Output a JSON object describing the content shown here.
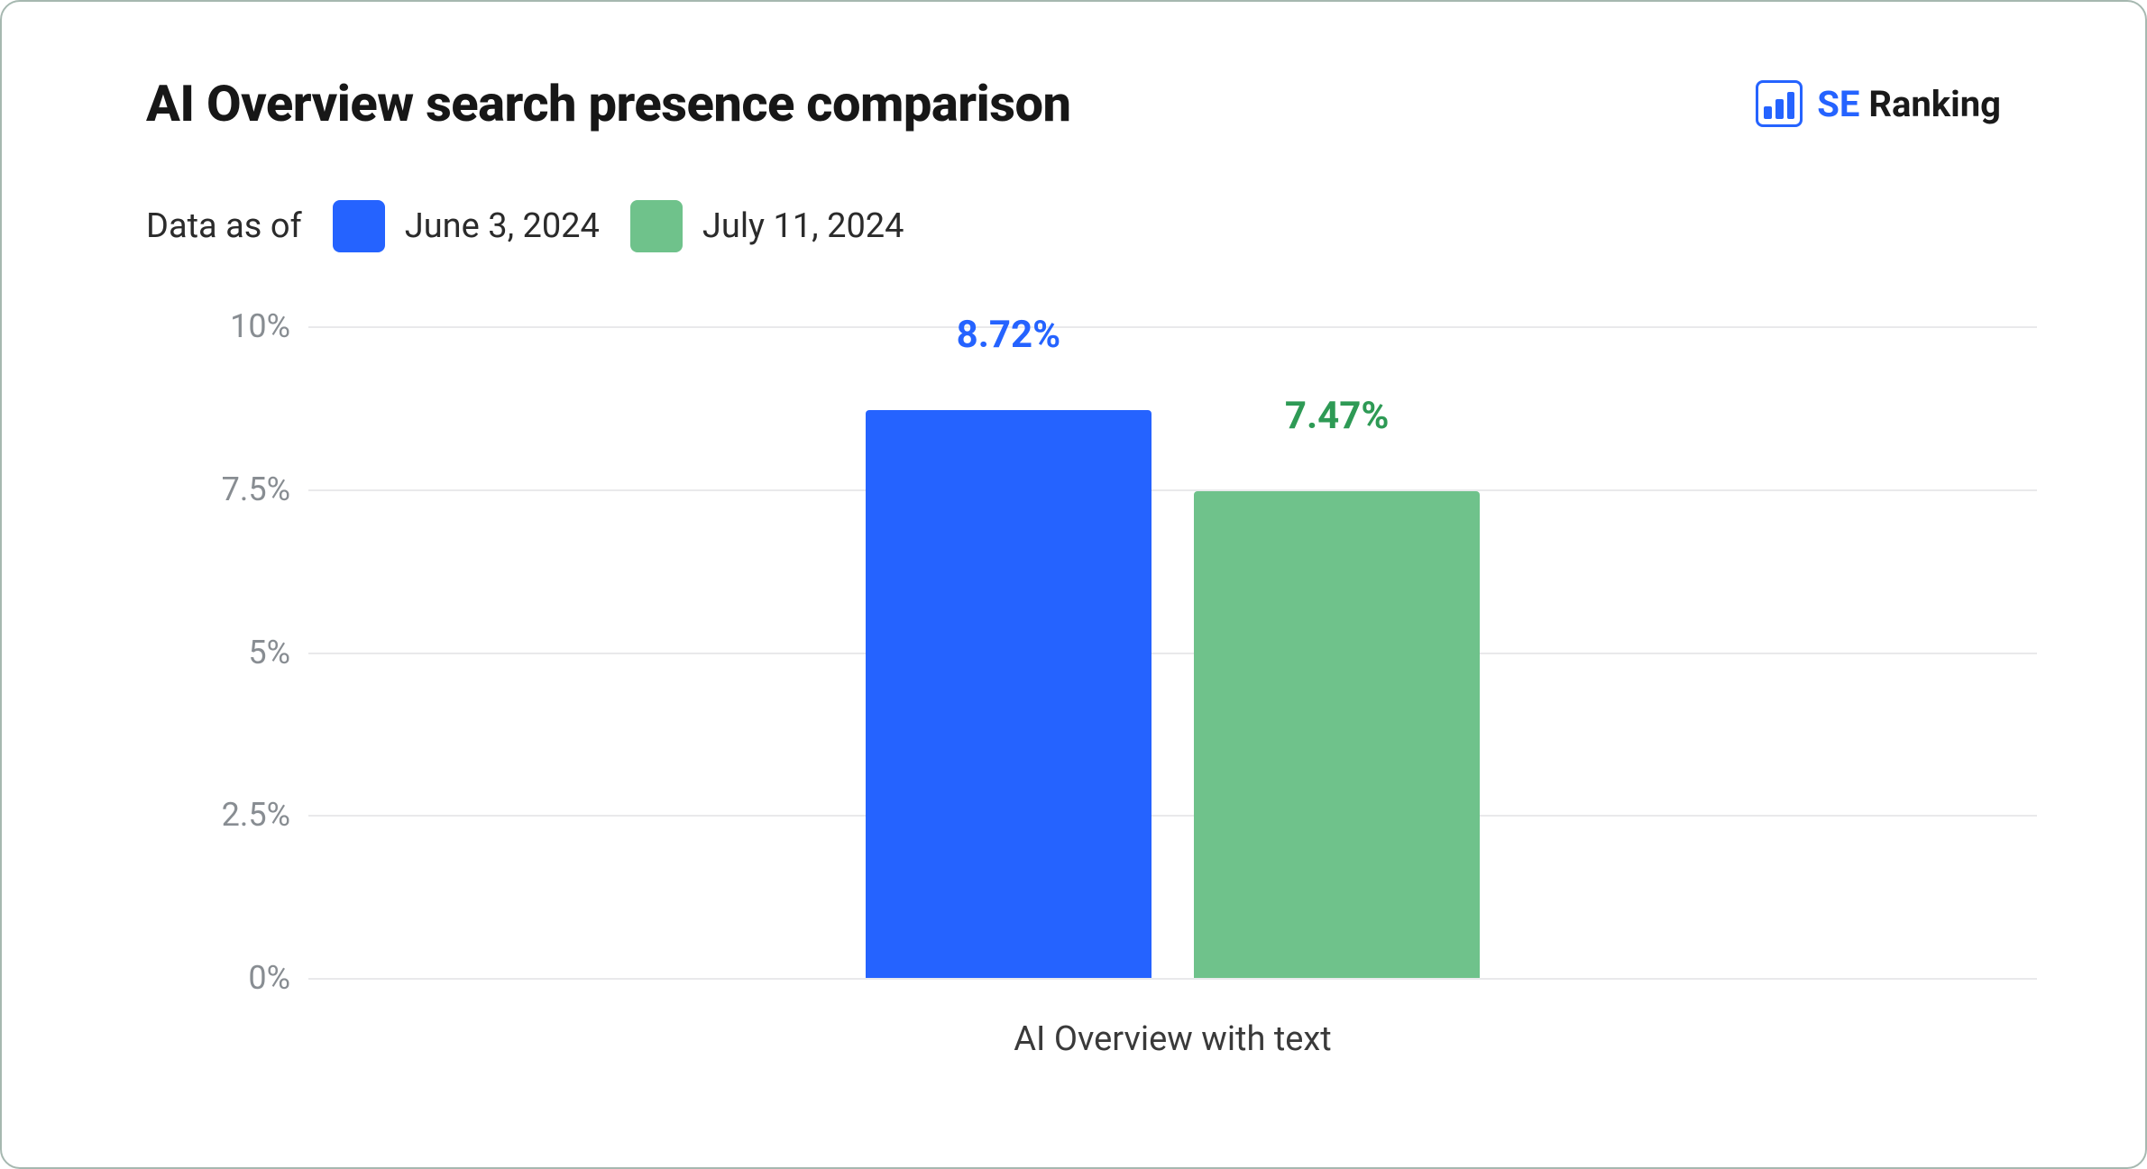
{
  "title": "AI Overview search presence comparison",
  "brand": {
    "se": "SE ",
    "ranking": "Ranking"
  },
  "legend": {
    "prefix": "Data as of",
    "items": [
      {
        "label": "June 3, 2024",
        "color": "#2563ff"
      },
      {
        "label": "July 11, 2024",
        "color": "#6fc28b"
      }
    ]
  },
  "chart_data": {
    "type": "bar",
    "categories": [
      "AI Overview with text"
    ],
    "series": [
      {
        "name": "June 3, 2024",
        "color": "#2563ff",
        "values": [
          8.72
        ],
        "value_labels": [
          "8.72%"
        ],
        "label_color": "#2563ff"
      },
      {
        "name": "July 11, 2024",
        "color": "#6fc28b",
        "values": [
          7.47
        ],
        "value_labels": [
          "7.47%"
        ],
        "label_color": "#2e9a55"
      }
    ],
    "yticks": [
      0,
      2.5,
      5,
      7.5,
      10
    ],
    "ytick_labels": [
      "0%",
      "2.5%",
      "5%",
      "7.5%",
      "10%"
    ],
    "ylim": [
      0,
      10
    ],
    "xlabel": "",
    "ylabel": "",
    "grid": true
  }
}
